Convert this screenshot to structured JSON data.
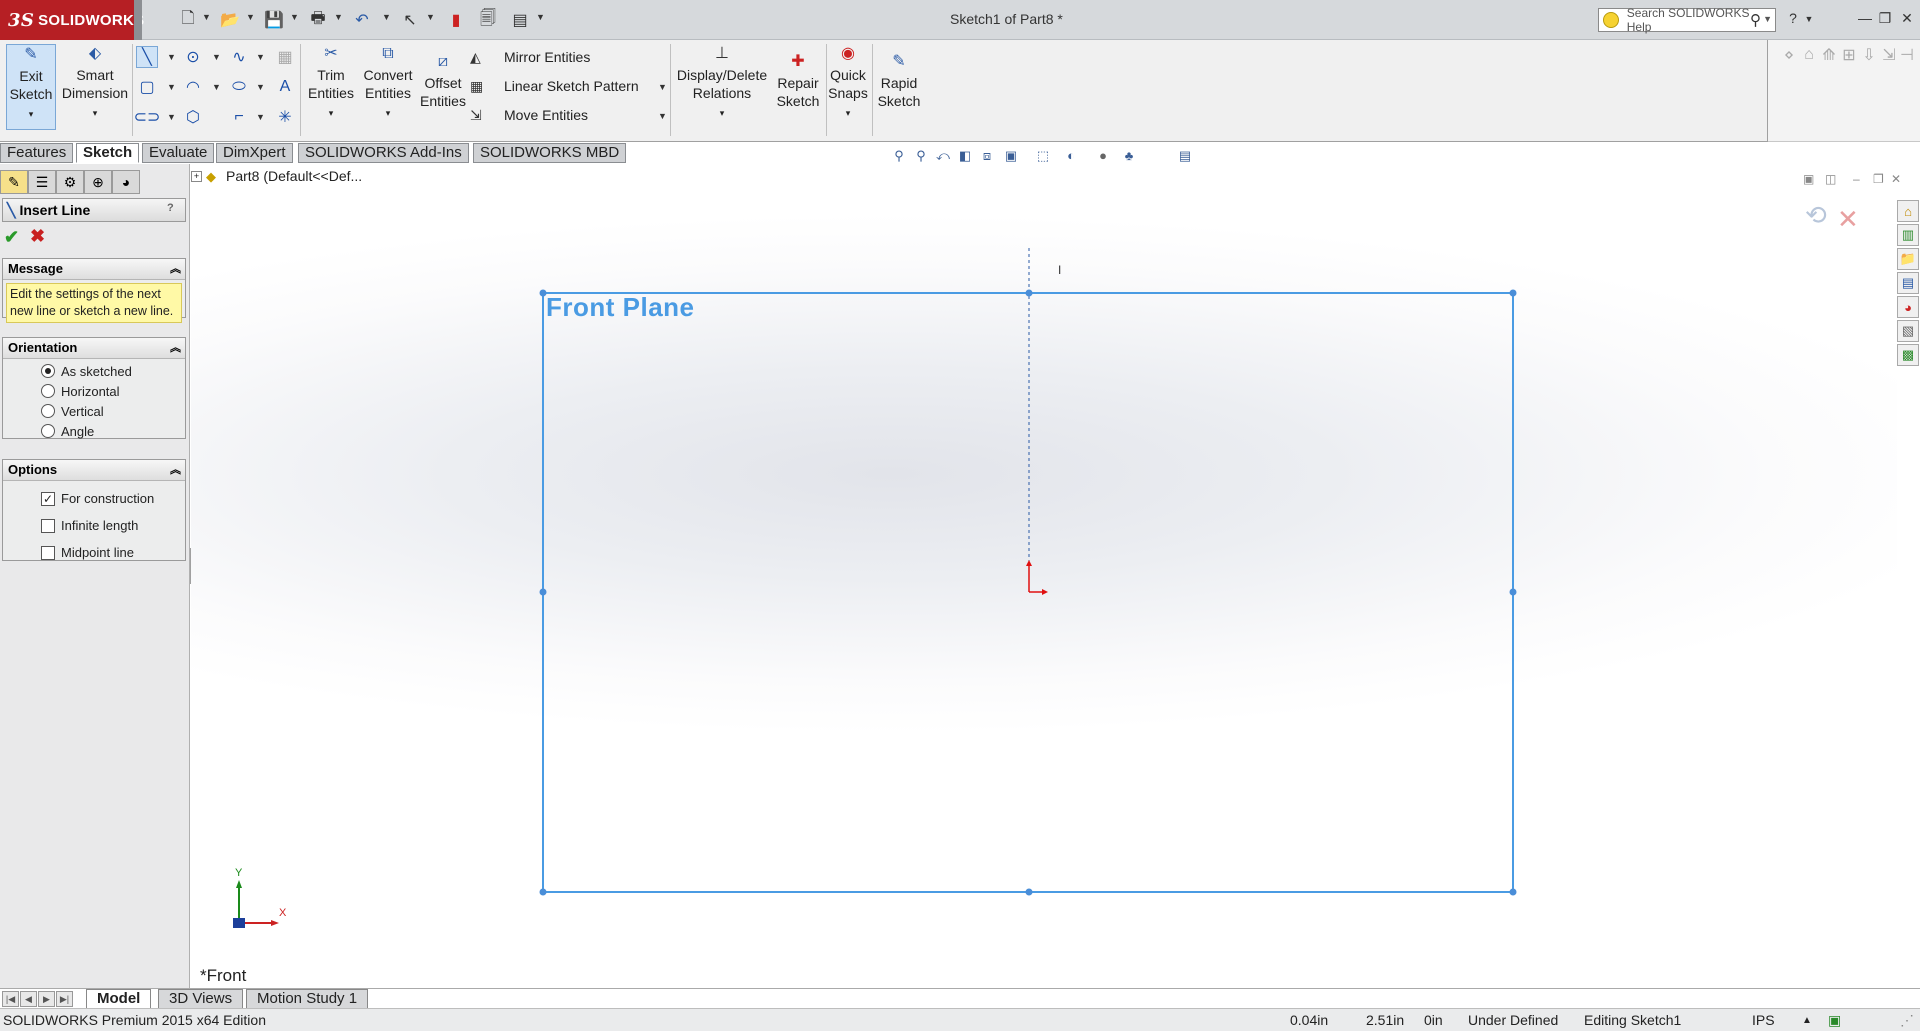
{
  "app": {
    "brand": "SOLIDWORKS",
    "document_title": "Sketch1 of Part8 *",
    "search_placeholder": "Search SOLIDWORKS Help"
  },
  "command_manager": {
    "exit_sketch": "Exit\nSketch",
    "smart_dimension": "Smart\nDimension",
    "trim_entities": "Trim\nEntities",
    "convert_entities": "Convert\nEntities",
    "offset_entities": "Offset\nEntities",
    "mirror_entities": "Mirror Entities",
    "linear_sketch_pattern": "Linear Sketch Pattern",
    "move_entities": "Move Entities",
    "display_delete_relations": "Display/Delete\nRelations",
    "repair_sketch": "Repair\nSketch",
    "quick_snaps": "Quick\nSnaps",
    "rapid_sketch": "Rapid\nSketch"
  },
  "tabs": [
    "Features",
    "Sketch",
    "Evaluate",
    "DimXpert",
    "SOLIDWORKS Add-Ins",
    "SOLIDWORKS MBD"
  ],
  "active_tab": "Sketch",
  "property_manager": {
    "title": "Insert Line",
    "help": "?",
    "message_header": "Message",
    "message_text": "Edit the settings of the next new line or sketch a new line.",
    "orientation_header": "Orientation",
    "orientation_options": [
      "As sketched",
      "Horizontal",
      "Vertical",
      "Angle"
    ],
    "orientation_selected": "As sketched",
    "options_header": "Options",
    "options": [
      {
        "label": "For construction",
        "checked": true
      },
      {
        "label": "Infinite length",
        "checked": false
      },
      {
        "label": "Midpoint line",
        "checked": false
      }
    ]
  },
  "graphics": {
    "tree_root": "Part8  (Default<<Def...",
    "plane_label": "Front Plane",
    "view_label": "*Front",
    "triad_x": "X",
    "triad_y": "Y",
    "cursor_text": "I"
  },
  "bottom_tabs": [
    "Model",
    "3D Views",
    "Motion Study 1"
  ],
  "active_bottom_tab": "Model",
  "status": {
    "edition": "SOLIDWORKS Premium 2015 x64 Edition",
    "x": "0.04in",
    "y": "2.51in",
    "z": "0in",
    "state": "Under Defined",
    "editing": "Editing Sketch1",
    "units": "IPS"
  },
  "colors": {
    "brand_red": "#b61f24",
    "sketch_blue": "#4a9be3",
    "message_yellow": "#fff9a6",
    "origin_red": "#e01010"
  }
}
